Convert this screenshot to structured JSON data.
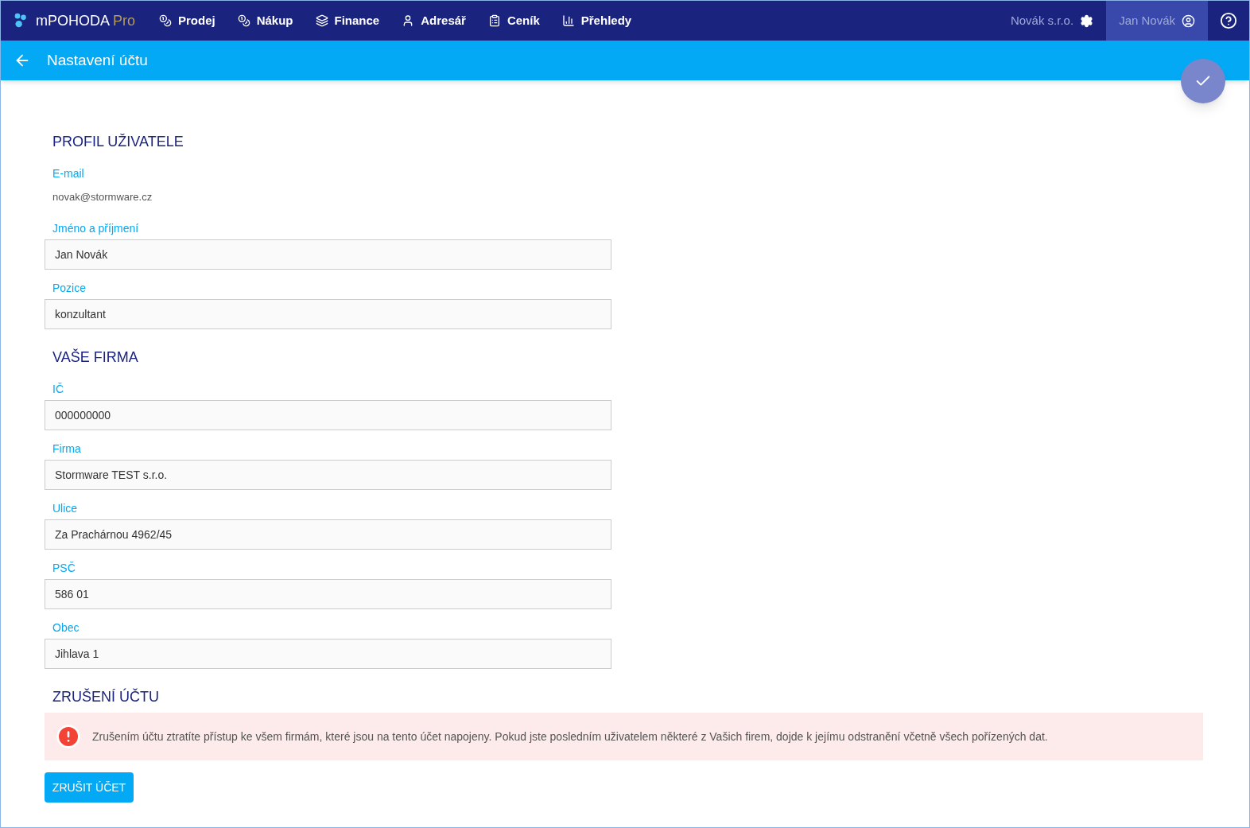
{
  "app": {
    "name": "mPOHODA",
    "edition": "Pro"
  },
  "nav": [
    {
      "label": "Prodej"
    },
    {
      "label": "Nákup"
    },
    {
      "label": "Finance"
    },
    {
      "label": "Adresář"
    },
    {
      "label": "Ceník"
    },
    {
      "label": "Přehledy"
    }
  ],
  "company": "Novák s.r.o.",
  "user": "Jan Novák",
  "page_title": "Nastavení účtu",
  "sections": [
    {
      "title": "PROFIL UŽIVATELE",
      "fields": [
        {
          "kind": "static",
          "label": "E-mail",
          "value": "novak@stormware.cz"
        },
        {
          "kind": "input",
          "label": "Jméno a příjmení",
          "value": "Jan Novák"
        },
        {
          "kind": "input",
          "label": "Pozice",
          "value": "konzultant"
        }
      ]
    },
    {
      "title": "VAŠE FIRMA",
      "fields": [
        {
          "kind": "input",
          "label": "IČ",
          "value": "000000000"
        },
        {
          "kind": "input",
          "label": "Firma",
          "value": "Stormware TEST s.r.o."
        },
        {
          "kind": "input",
          "label": "Ulice",
          "value": "Za Prachárnou 4962/45"
        },
        {
          "kind": "input",
          "label": "PSČ",
          "value": "586 01"
        },
        {
          "kind": "input",
          "label": "Obec",
          "value": "Jihlava 1"
        }
      ]
    }
  ],
  "cancel": {
    "title": "ZRUŠENÍ ÚČTU",
    "warning": "Zrušením účtu ztratíte přístup ke všem firmám, které jsou na tento účet napojeny. Pokud jste posledním uživatelem některé z Vašich firem, dojde k jejímu odstranění včetně všech pořízených dat.",
    "button": "ZRUŠIT ÚČET"
  }
}
